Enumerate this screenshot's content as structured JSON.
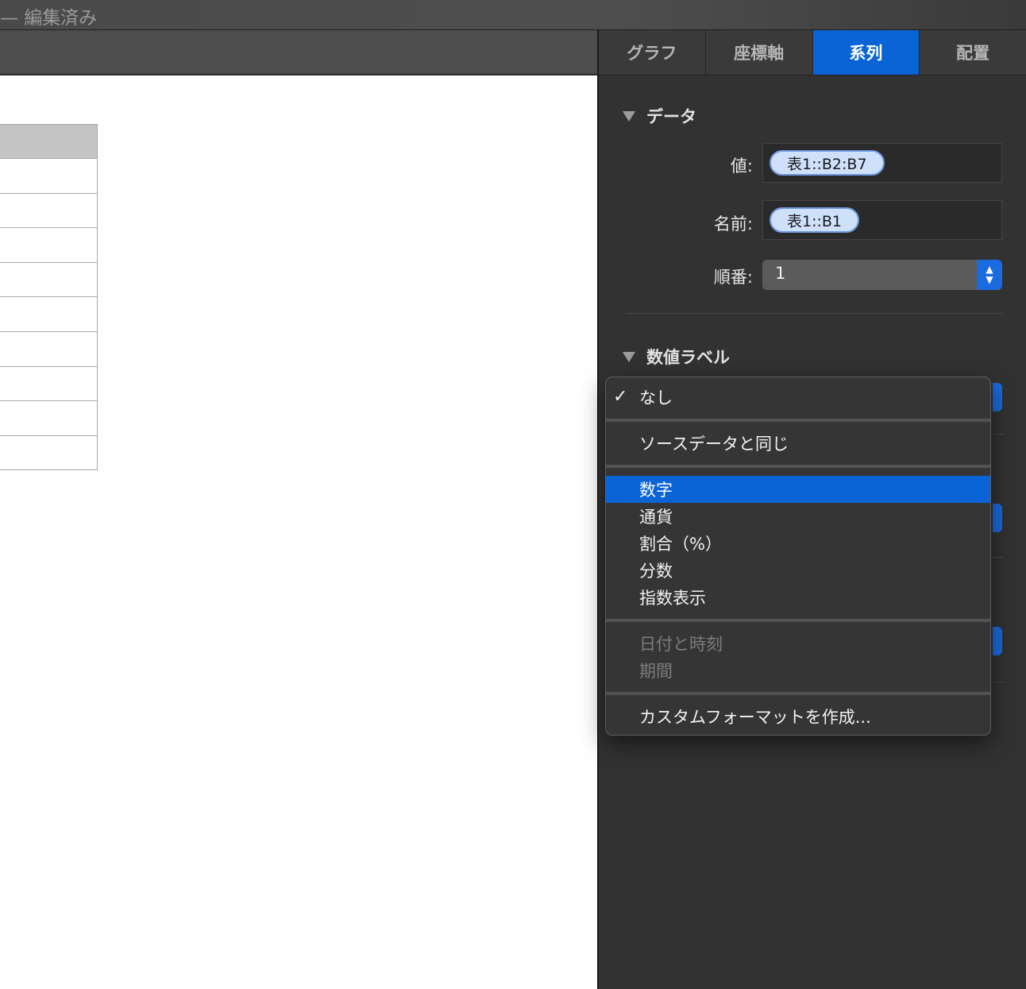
{
  "window": {
    "title": "— 編集済み"
  },
  "inspector": {
    "tabs": [
      {
        "label": "グラフ",
        "active": false
      },
      {
        "label": "座標軸",
        "active": false
      },
      {
        "label": "系列",
        "active": true
      },
      {
        "label": "配置",
        "active": false
      }
    ],
    "data_section": {
      "title": "データ",
      "value_label": "値:",
      "value_token": "表1::B2:B7",
      "name_label": "名前:",
      "name_token": "表1::B1",
      "order_label": "順番:",
      "order_value": "1"
    },
    "value_labels_section": {
      "title": "数値ラベル"
    }
  },
  "format_menu": {
    "items": {
      "none": "なし",
      "same_as_source": "ソースデータと同じ",
      "number": "数字",
      "currency": "通貨",
      "percent": "割合（%）",
      "fraction": "分数",
      "scientific": "指数表示",
      "date_time": "日付と時刻",
      "duration": "期間",
      "custom": "カスタムフォーマットを作成..."
    },
    "checked": "なし",
    "highlighted": "数字",
    "checkmark": "✓"
  },
  "colors": {
    "accent": "#0a64d6",
    "panel": "#323232"
  }
}
